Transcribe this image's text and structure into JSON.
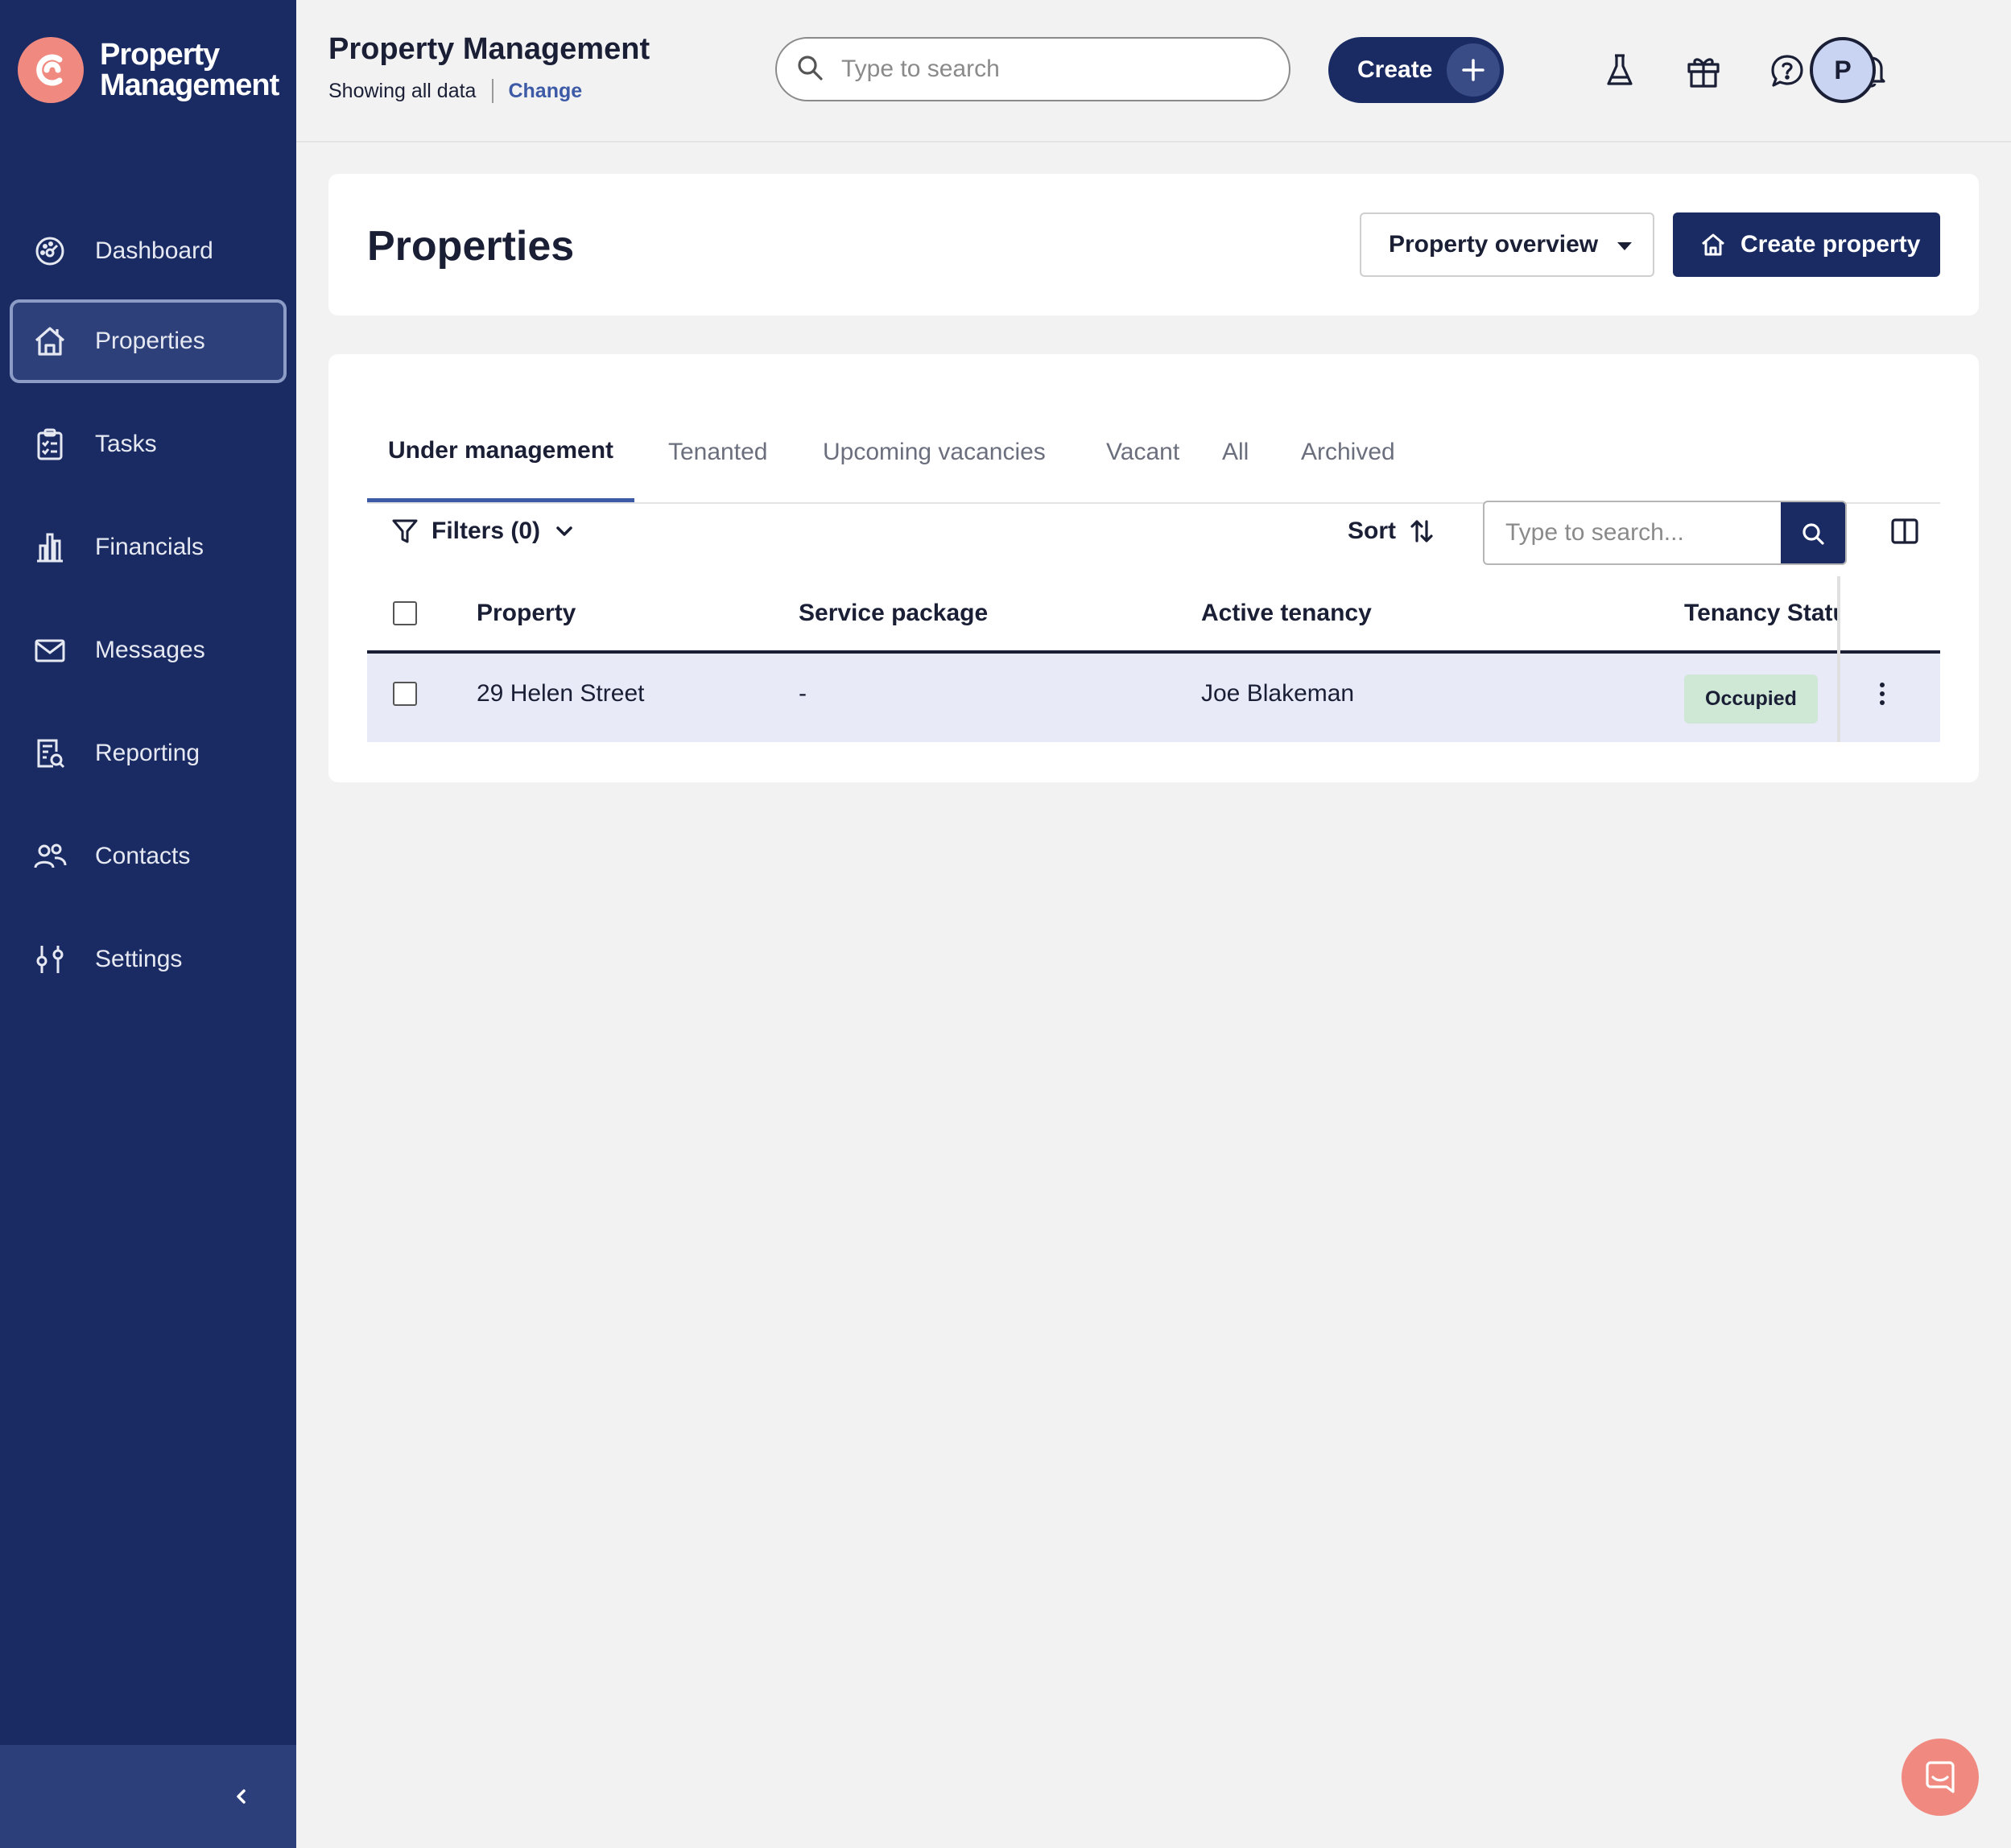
{
  "brand": {
    "line1": "Property",
    "line2": "Management"
  },
  "sidebar": {
    "items": [
      {
        "label": "Dashboard",
        "icon": "gauge-icon"
      },
      {
        "label": "Properties",
        "icon": "house-icon",
        "active": true
      },
      {
        "label": "Tasks",
        "icon": "clipboard-icon"
      },
      {
        "label": "Financials",
        "icon": "bar-chart-icon"
      },
      {
        "label": "Messages",
        "icon": "envelope-icon"
      },
      {
        "label": "Reporting",
        "icon": "report-search-icon"
      },
      {
        "label": "Contacts",
        "icon": "people-icon"
      },
      {
        "label": "Settings",
        "icon": "sliders-icon"
      }
    ],
    "collapse_icon": "chevron-left-icon"
  },
  "header": {
    "title": "Property Management",
    "subtitle": "Showing all data",
    "change_link": "Change",
    "search_placeholder": "Type to search",
    "create_label": "Create",
    "icons": [
      "flask-icon",
      "gift-icon",
      "help-icon",
      "bell-icon"
    ],
    "avatar_initial": "P"
  },
  "page": {
    "title": "Properties",
    "overview_label": "Property overview",
    "create_property_label": "Create property"
  },
  "tabs": [
    {
      "label": "Under management",
      "active": true
    },
    {
      "label": "Tenanted"
    },
    {
      "label": "Upcoming vacancies"
    },
    {
      "label": "Vacant"
    },
    {
      "label": "All"
    },
    {
      "label": "Archived"
    }
  ],
  "toolbar": {
    "filters_label": "Filters (0)",
    "sort_label": "Sort",
    "search_placeholder": "Type to search..."
  },
  "table": {
    "columns": [
      "Property",
      "Service package",
      "Active tenancy",
      "Tenancy Status"
    ],
    "rows": [
      {
        "property": "29 Helen Street",
        "service_package": "-",
        "active_tenancy": "Joe Blakeman",
        "status": "Occupied"
      }
    ]
  },
  "colors": {
    "sidebar": "#1a2b63",
    "accent": "#3c5aa6",
    "brand": "#f08a80",
    "status_occupied": "#cfe8d6",
    "row_highlight": "#e8ebf7"
  }
}
